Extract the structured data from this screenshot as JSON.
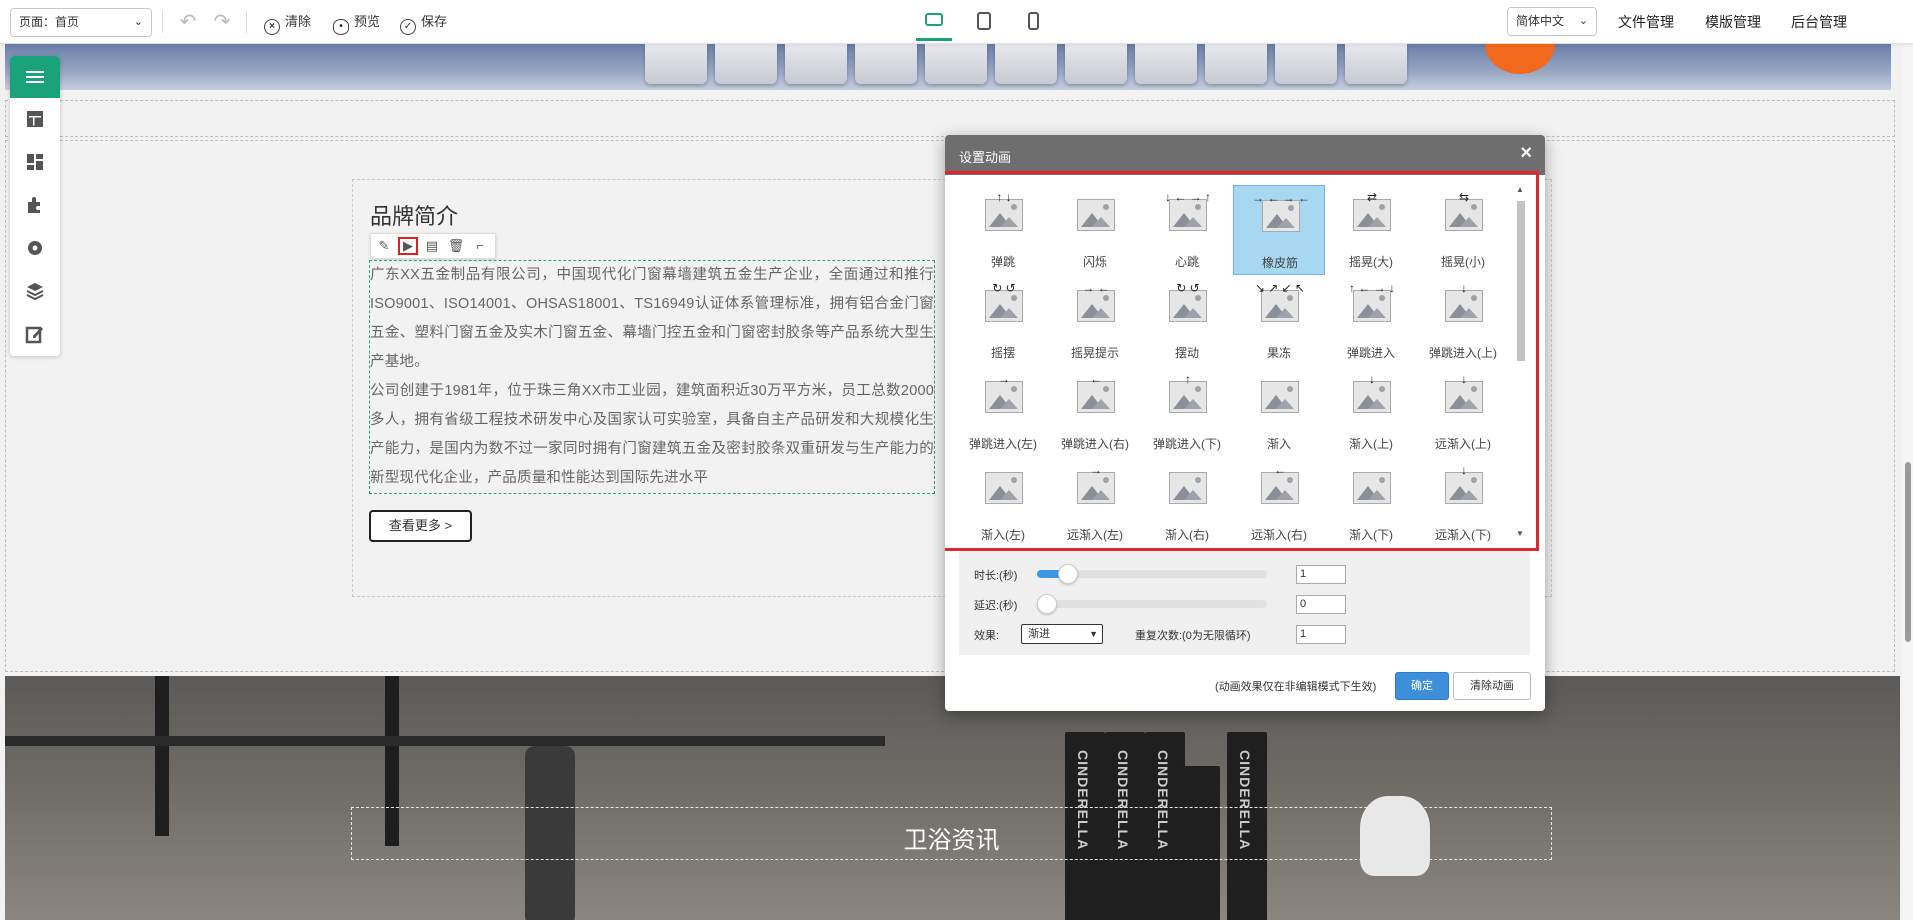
{
  "toolbar": {
    "page_select": "页面：首页",
    "clear": "清除",
    "preview": "预览",
    "save": "保存",
    "language": "简体中文",
    "file_manage": "文件管理",
    "template_manage": "模版管理",
    "admin": "后台管理"
  },
  "content": {
    "brand_title": "品牌简介",
    "paragraph1": "广东XX五金制品有限公司，中国现代化门窗幕墙建筑五金生产企业，全面通过和推行ISO9001、ISO14001、OHSAS18001、TS16949认证体系管理标准，拥有铝合金门窗五金、塑料门窗五金及实木门窗五金、幕墙门控五金和门窗密封胶条等产品系统大型生产基地。",
    "paragraph2": "公司创建于1981年，位于珠三角XX市工业园，建筑面积近30万平方米，员工总数2000多人，拥有省级工程技术研发中心及国家认可实验室，具备自主产品研发和大规模化生产能力，是国内为数不过一家同时拥有门窗建筑五金及密封胶条双重研发与生产能力的新型现代化企业，产品质量和性能达到国际先进水平",
    "more_button": "查看更多 >",
    "news_title": "卫浴资讯",
    "book_spine": "CINDERELLA"
  },
  "dialog": {
    "title": "设置动画",
    "close": "×",
    "animations": [
      {
        "label": "弹跳",
        "arrows": "↑ ↓"
      },
      {
        "label": "闪烁",
        "arrows": ""
      },
      {
        "label": "心跳",
        "arrows": "↓ ← → ↑"
      },
      {
        "label": "橡皮筋",
        "arrows": "→ ← → ←"
      },
      {
        "label": "摇晃(大)",
        "arrows": "⇄"
      },
      {
        "label": "摇晃(小)",
        "arrows": "⇆"
      },
      {
        "label": "摇摆",
        "arrows": "↻ ↺"
      },
      {
        "label": "摇晃提示",
        "arrows": "→ ←"
      },
      {
        "label": "摆动",
        "arrows": "↻ ↺"
      },
      {
        "label": "果冻",
        "arrows": "↘ ↗ ↙ ↖"
      },
      {
        "label": "弹跳进入",
        "arrows": "↑ ← → ↓"
      },
      {
        "label": "弹跳进入(上)",
        "arrows": "↓"
      },
      {
        "label": "弹跳进入(左)",
        "arrows": "→"
      },
      {
        "label": "弹跳进入(右)",
        "arrows": "←"
      },
      {
        "label": "弹跳进入(下)",
        "arrows": "↑"
      },
      {
        "label": "渐入",
        "arrows": ""
      },
      {
        "label": "渐入(上)",
        "arrows": "↓"
      },
      {
        "label": "远渐入(上)",
        "arrows": "↓"
      },
      {
        "label": "渐入(左)",
        "arrows": ""
      },
      {
        "label": "远渐入(左)",
        "arrows": "→"
      },
      {
        "label": "渐入(右)",
        "arrows": ""
      },
      {
        "label": "远渐入(右)",
        "arrows": "←"
      },
      {
        "label": "渐入(下)",
        "arrows": ""
      },
      {
        "label": "远渐入(下)",
        "arrows": "↓"
      }
    ],
    "selected_animation": "橡皮筋",
    "duration_label": "时长:(秒)",
    "duration_value": "1",
    "duration_fraction": 0.05,
    "delay_label": "延迟:(秒)",
    "delay_value": "0",
    "delay_fraction": 0,
    "effect_label": "效果:",
    "effect_value": "渐进",
    "repeat_label": "重复次数:(0为无限循环)",
    "repeat_value": "1",
    "note": "(动画效果仅在非编辑模式下生效)",
    "confirm": "确定",
    "clear_animation": "清除动画"
  },
  "colors": {
    "accent": "#1aa37a",
    "primary_button": "#3c8fd8",
    "highlight_frame": "#e0262e",
    "selected_cell": "#a8d7f2"
  }
}
